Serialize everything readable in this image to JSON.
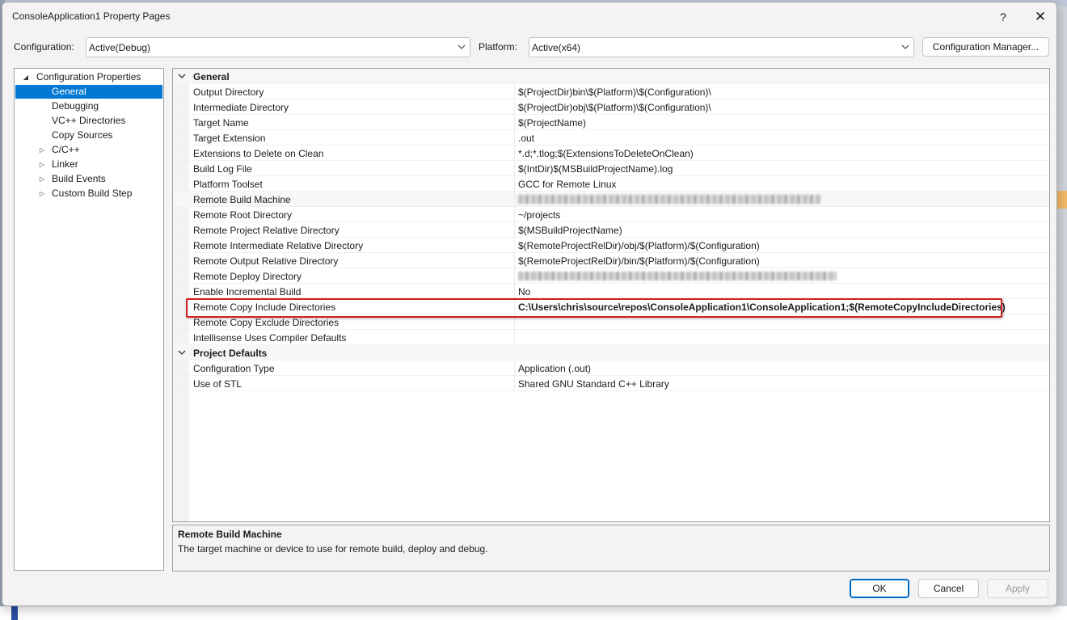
{
  "window": {
    "title": "ConsoleApplication1 Property Pages",
    "help": "?",
    "close": "✕"
  },
  "config_bar": {
    "configuration_label": "Configuration:",
    "configuration_value": "Active(Debug)",
    "platform_label": "Platform:",
    "platform_value": "Active(x64)",
    "manager_button": "Configuration Manager..."
  },
  "tree": {
    "root": "Configuration Properties",
    "items": [
      "General",
      "Debugging",
      "VC++ Directories",
      "Copy Sources",
      "C/C++",
      "Linker",
      "Build Events",
      "Custom Build Step"
    ],
    "selected": "General"
  },
  "grid": {
    "categories": [
      "General",
      "Project Defaults"
    ],
    "general": [
      {
        "name": "Output Directory",
        "value": "$(ProjectDir)bin\\$(Platform)\\$(Configuration)\\"
      },
      {
        "name": "Intermediate Directory",
        "value": "$(ProjectDir)obj\\$(Platform)\\$(Configuration)\\"
      },
      {
        "name": "Target Name",
        "value": "$(ProjectName)"
      },
      {
        "name": "Target Extension",
        "value": ".out"
      },
      {
        "name": "Extensions to Delete on Clean",
        "value": "*.d;*.tlog;$(ExtensionsToDeleteOnClean)"
      },
      {
        "name": "Build Log File",
        "value": "$(IntDir)$(MSBuildProjectName).log"
      },
      {
        "name": "Platform Toolset",
        "value": "GCC for Remote Linux"
      },
      {
        "name": "Remote Build Machine",
        "value": ""
      },
      {
        "name": "Remote Root Directory",
        "value": "~/projects"
      },
      {
        "name": "Remote Project Relative Directory",
        "value": "$(MSBuildProjectName)"
      },
      {
        "name": "Remote Intermediate Relative Directory",
        "value": "$(RemoteProjectRelDir)/obj/$(Platform)/$(Configuration)"
      },
      {
        "name": "Remote Output Relative Directory",
        "value": "$(RemoteProjectRelDir)/bin/$(Platform)/$(Configuration)"
      },
      {
        "name": "Remote Deploy Directory",
        "value": ""
      },
      {
        "name": "Enable Incremental Build",
        "value": "No"
      },
      {
        "name": "Remote Copy Include Directories",
        "value": "C:\\Users\\chris\\source\\repos\\ConsoleApplication1\\ConsoleApplication1;$(RemoteCopyIncludeDirectories)"
      },
      {
        "name": "Remote Copy Exclude Directories",
        "value": ""
      },
      {
        "name": "Intellisense Uses Compiler Defaults",
        "value": ""
      }
    ],
    "project_defaults": [
      {
        "name": "Configuration Type",
        "value": "Application (.out)"
      },
      {
        "name": "Use of STL",
        "value": "Shared GNU Standard C++ Library"
      }
    ]
  },
  "description": {
    "title": "Remote Build Machine",
    "text": "The target machine or device to use for remote build, deploy and debug."
  },
  "buttons": {
    "ok": "OK",
    "cancel": "Cancel",
    "apply": "Apply"
  }
}
